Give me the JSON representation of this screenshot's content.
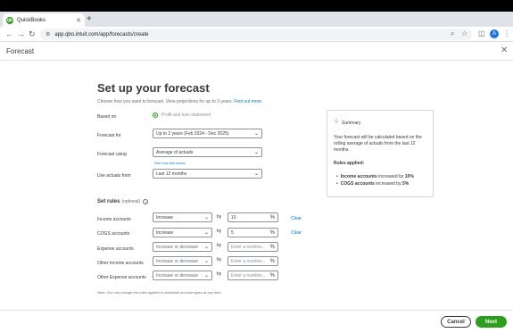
{
  "browser": {
    "tab_title": "QuickBooks",
    "tab_favicon": "qb",
    "url": "app.qbo.intuit.com/app/forecasts/create",
    "profile_initial": "A"
  },
  "header": {
    "title": "Forecast"
  },
  "form": {
    "title": "Set up your forecast",
    "subtitle": "Choose how you want to forecast. View projections for up to 3 years.",
    "find_out_more": "Find out more",
    "based_on": {
      "label": "Based on",
      "value": "Profit and loss statement"
    },
    "forecast_for": {
      "label": "Forecast for",
      "value": "Up to 2 years (Feb 2024 - Dec 2025)"
    },
    "forecast_using": {
      "label": "Forecast using",
      "value": "Average of actuals",
      "help_link": "See how this works"
    },
    "use_actuals_from": {
      "label": "Use actuals from",
      "value": "Last 12 months"
    }
  },
  "summary": {
    "title": "Summary",
    "text": "Your forecast will be calculated based on the rolling average of actuals from the last 12 months.",
    "rules_title": "Rules applied:",
    "rules": [
      {
        "name": "Income accounts",
        "text": " increased by ",
        "value": "10%"
      },
      {
        "name": "COGS accounts",
        "text": " increased by ",
        "value": "5%"
      }
    ]
  },
  "rules": {
    "title": "Set rules",
    "optional": "(optional)",
    "by_label": "by",
    "clear_label": "Clear",
    "rows": [
      {
        "label": "Income accounts",
        "mode": "Increase",
        "value": "10",
        "placeholder": ""
      },
      {
        "label": "COGS accounts",
        "mode": "Increase",
        "value": "5",
        "placeholder": ""
      },
      {
        "label": "Expense accounts",
        "mode": "Increase or decrease",
        "value": "",
        "placeholder": "Enter a number..."
      },
      {
        "label": "Other Income accounts",
        "mode": "Increase or decrease",
        "value": "",
        "placeholder": "Enter a number..."
      },
      {
        "label": "Other Expense accounts",
        "mode": "Increase or decrease",
        "value": "",
        "placeholder": "Enter a number..."
      }
    ],
    "note": "Note: You can change the rules applied to individual account types at any time."
  },
  "footer": {
    "cancel": "Cancel",
    "next": "Next"
  },
  "colors": {
    "brand_green": "#2ca01c",
    "link_blue": "#0077c5"
  }
}
